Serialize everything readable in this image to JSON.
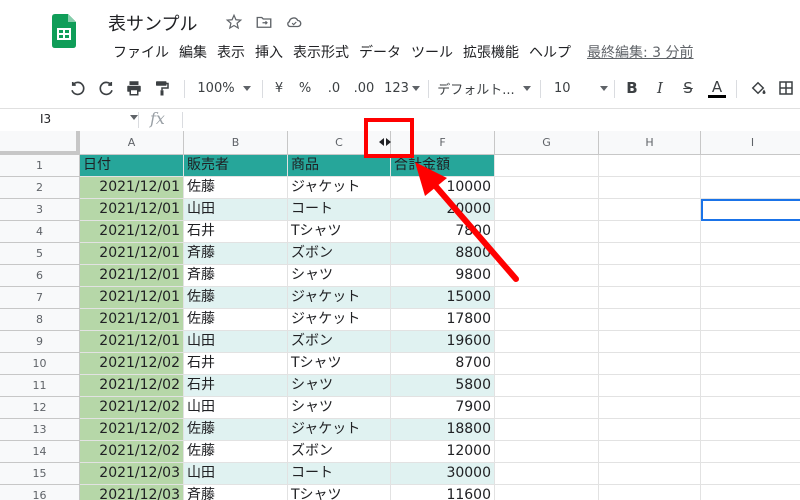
{
  "header": {
    "title": "表サンプル",
    "menus": [
      "ファイル",
      "編集",
      "表示",
      "挿入",
      "表示形式",
      "データ",
      "ツール",
      "拡張機能",
      "ヘルプ"
    ],
    "last_edit": "最終編集: 3 分前"
  },
  "toolbar": {
    "zoom": "100%",
    "currency": "¥",
    "percent": "%",
    "decrease_decimal": ".0",
    "increase_decimal": ".00",
    "more_formats": "123",
    "font": "デフォルト...",
    "font_size": "10",
    "bold": "B",
    "italic": "I",
    "strikethrough": "S",
    "text_color": "A"
  },
  "formula_bar": {
    "name_box": "I3",
    "fx": "fx"
  },
  "grid": {
    "columns": [
      "A",
      "B",
      "C",
      "F",
      "G",
      "H",
      "I"
    ],
    "rows": [
      {
        "n": "1",
        "date": "日付",
        "seller": "販売者",
        "product": "商品",
        "amount": "合計金額"
      },
      {
        "n": "2",
        "date": "2021/12/01",
        "seller": "佐藤",
        "product": "ジャケット",
        "amount": "10000"
      },
      {
        "n": "3",
        "date": "2021/12/01",
        "seller": "山田",
        "product": "コート",
        "amount": "20000"
      },
      {
        "n": "4",
        "date": "2021/12/01",
        "seller": "石井",
        "product": "Tシャツ",
        "amount": "7800"
      },
      {
        "n": "5",
        "date": "2021/12/01",
        "seller": "斉藤",
        "product": "ズボン",
        "amount": "8800"
      },
      {
        "n": "6",
        "date": "2021/12/01",
        "seller": "斉藤",
        "product": "シャツ",
        "amount": "9800"
      },
      {
        "n": "7",
        "date": "2021/12/01",
        "seller": "佐藤",
        "product": "ジャケット",
        "amount": "15000"
      },
      {
        "n": "8",
        "date": "2021/12/01",
        "seller": "佐藤",
        "product": "ジャケット",
        "amount": "17800"
      },
      {
        "n": "9",
        "date": "2021/12/01",
        "seller": "山田",
        "product": "ズボン",
        "amount": "19600"
      },
      {
        "n": "10",
        "date": "2021/12/02",
        "seller": "石井",
        "product": "Tシャツ",
        "amount": "8700"
      },
      {
        "n": "11",
        "date": "2021/12/02",
        "seller": "石井",
        "product": "シャツ",
        "amount": "5800"
      },
      {
        "n": "12",
        "date": "2021/12/02",
        "seller": "山田",
        "product": "シャツ",
        "amount": "7900"
      },
      {
        "n": "13",
        "date": "2021/12/02",
        "seller": "佐藤",
        "product": "ジャケット",
        "amount": "18800"
      },
      {
        "n": "14",
        "date": "2021/12/02",
        "seller": "佐藤",
        "product": "ズボン",
        "amount": "12000"
      },
      {
        "n": "15",
        "date": "2021/12/03",
        "seller": "山田",
        "product": "コート",
        "amount": "30000"
      },
      {
        "n": "16",
        "date": "2021/12/03",
        "seller": "斉藤",
        "product": "Tシャツ",
        "amount": "11600"
      }
    ]
  },
  "colors": {
    "header_fill": "#26a69a",
    "band_fill": "#e0f2f1",
    "date_fill": "#b6d7a8",
    "annotation": "#ff0000",
    "selection": "#1a73e8"
  }
}
